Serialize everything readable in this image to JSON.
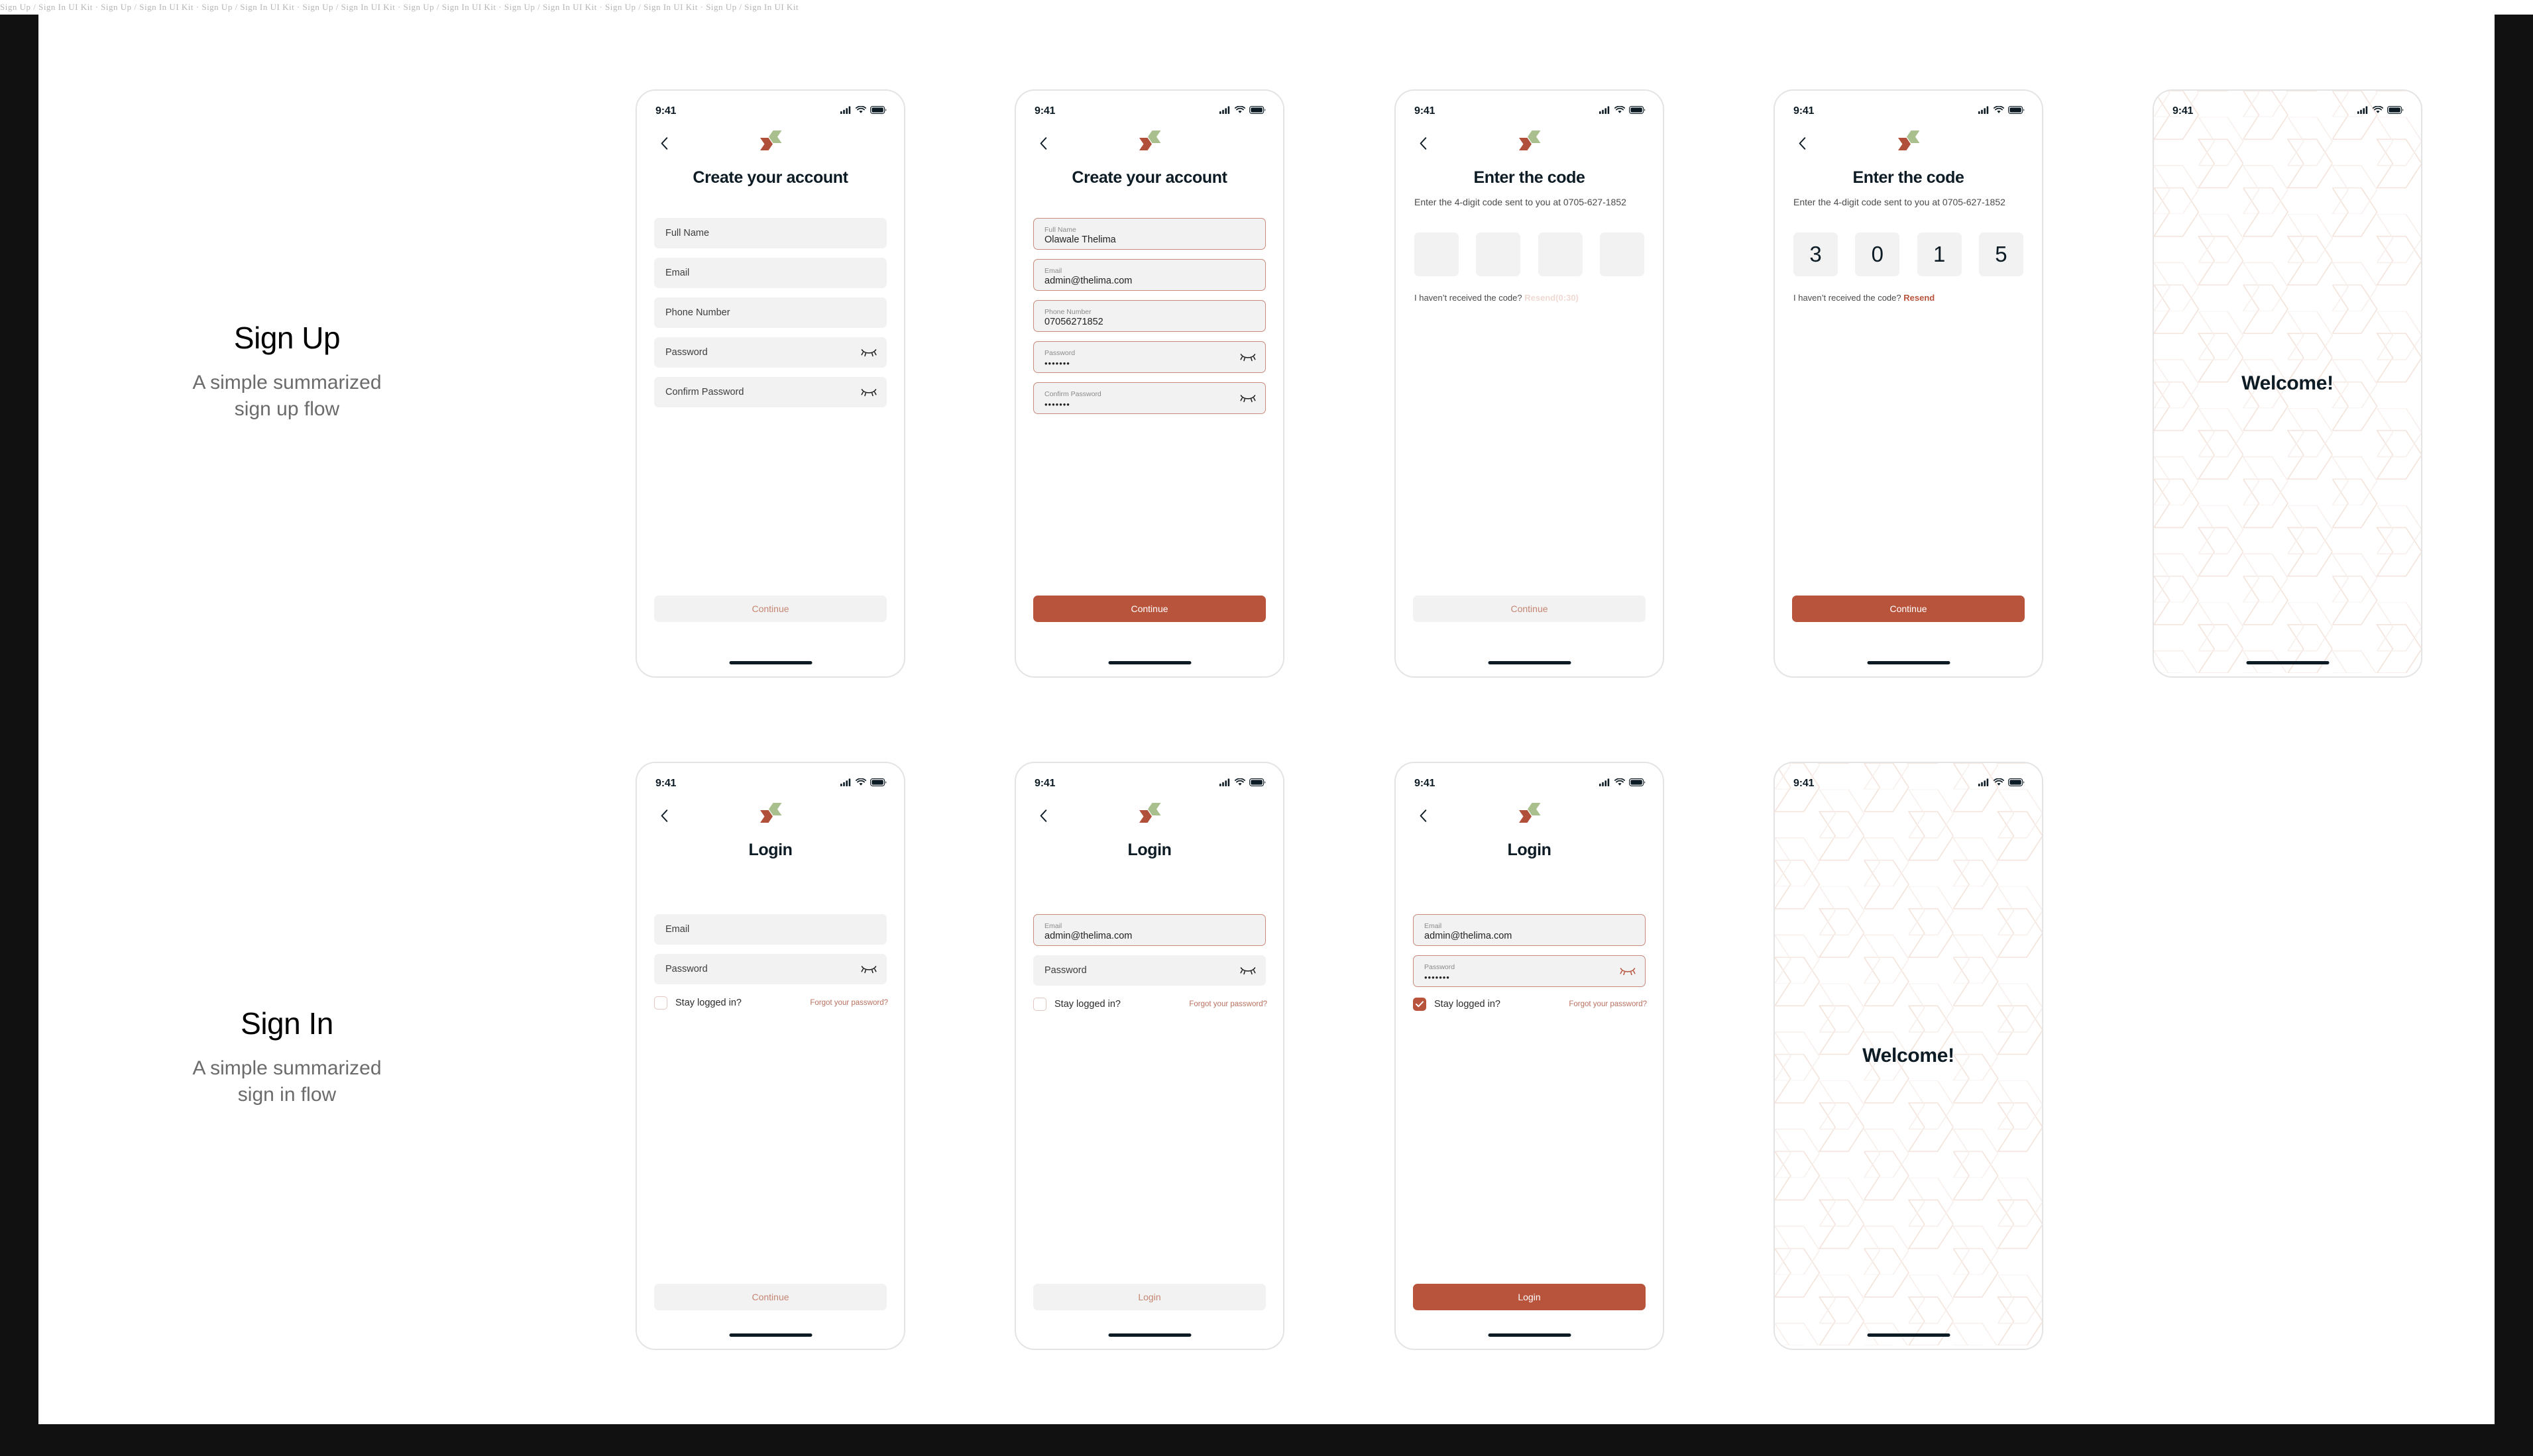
{
  "watermark": "Sign Up / Sign In UI Kit · Sign Up / Sign In UI Kit · Sign Up / Sign In UI Kit · Sign Up / Sign In UI Kit · Sign Up / Sign In UI Kit · Sign Up / Sign In UI Kit · Sign Up / Sign In UI Kit · Sign Up / Sign In UI Kit",
  "colors": {
    "primary": "#b9543c",
    "primary_muted": "#c58573",
    "primary_faint": "#f0d9d2",
    "field_bg": "#f2f2f2",
    "field_border_filled": "#c78b7c",
    "text_dark": "#0d1b25",
    "logo_red": "#b0503a",
    "logo_green": "#a9bf8e",
    "pattern_line": "#f3e4dd"
  },
  "sections": [
    {
      "id": "signup",
      "title": "Sign Up",
      "subtitle": "A simple summarized\nsign up flow"
    },
    {
      "id": "signin",
      "title": "Sign In",
      "subtitle": "A simple summarized\nsign in flow"
    }
  ],
  "status_bar": {
    "time": "9:41",
    "icons": [
      "cellular-signal-icon",
      "wifi-icon",
      "battery-icon"
    ]
  },
  "screens": {
    "signup_empty": {
      "name": "Create your account (empty)",
      "title": "Create your account",
      "fields": [
        {
          "placeholder": "Full Name",
          "type": "text"
        },
        {
          "placeholder": "Email",
          "type": "text"
        },
        {
          "placeholder": "Phone Number",
          "type": "text"
        },
        {
          "placeholder": "Password",
          "type": "password"
        },
        {
          "placeholder": "Confirm Password",
          "type": "password"
        }
      ],
      "cta": {
        "label": "Continue",
        "state": "disabled"
      }
    },
    "signup_filled": {
      "name": "Create your account (filled)",
      "title": "Create your account",
      "fields": [
        {
          "label": "Full Name",
          "value": "Olawale Thelima",
          "type": "text"
        },
        {
          "label": "Email",
          "value": "admin@thelima.com",
          "type": "text"
        },
        {
          "label": "Phone Number",
          "value": "07056271852",
          "type": "text"
        },
        {
          "label": "Password",
          "value": "•••••••",
          "type": "password"
        },
        {
          "label": "Confirm Password",
          "value": "•••••••",
          "type": "password"
        }
      ],
      "cta": {
        "label": "Continue",
        "state": "enabled"
      }
    },
    "otp_empty": {
      "name": "Enter the code (empty)",
      "title": "Enter the code",
      "subtitle": "Enter the 4-digit code sent to you at 0705-627-1852",
      "digits": [
        "",
        "",
        "",
        ""
      ],
      "resend_prefix": "I haven’t received the code?",
      "resend_label": "Resend(0:30)",
      "resend_state": "muted",
      "cta": {
        "label": "Continue",
        "state": "disabled"
      }
    },
    "otp_filled": {
      "name": "Enter the code (filled)",
      "title": "Enter the code",
      "subtitle": "Enter the 4-digit code sent to you at 0705-627-1852",
      "digits": [
        "3",
        "0",
        "1",
        "5"
      ],
      "resend_prefix": "I haven’t received the code?",
      "resend_label": "Resend",
      "resend_state": "active",
      "cta": {
        "label": "Continue",
        "state": "enabled"
      }
    },
    "welcome_signup": {
      "name": "Welcome (sign up)",
      "text": "Welcome!"
    },
    "login_empty": {
      "name": "Login (empty)",
      "title": "Login",
      "fields": [
        {
          "placeholder": "Email",
          "type": "text"
        },
        {
          "placeholder": "Password",
          "type": "password"
        }
      ],
      "stay_logged_in": {
        "label": "Stay logged in?",
        "checked": false
      },
      "forgot_label": "Forgot your password?",
      "cta": {
        "label": "Continue",
        "state": "disabled"
      }
    },
    "login_email": {
      "name": "Login (email entered)",
      "title": "Login",
      "fields": [
        {
          "label": "Email",
          "value": "admin@thelima.com",
          "type": "text",
          "filled": true
        },
        {
          "placeholder": "Password",
          "type": "password",
          "filled": false
        }
      ],
      "stay_logged_in": {
        "label": "Stay logged in?",
        "checked": false
      },
      "forgot_label": "Forgot your password?",
      "cta": {
        "label": "Login",
        "state": "disabled"
      }
    },
    "login_filled": {
      "name": "Login (filled)",
      "title": "Login",
      "fields": [
        {
          "label": "Email",
          "value": "admin@thelima.com",
          "type": "text",
          "filled": true
        },
        {
          "label": "Password",
          "value": "•••••••",
          "type": "password",
          "filled": true
        }
      ],
      "stay_logged_in": {
        "label": "Stay logged in?",
        "checked": true
      },
      "forgot_label": "Forgot your password?",
      "cta": {
        "label": "Login",
        "state": "enabled"
      }
    },
    "welcome_login": {
      "name": "Welcome (sign in)",
      "text": "Welcome!"
    }
  }
}
